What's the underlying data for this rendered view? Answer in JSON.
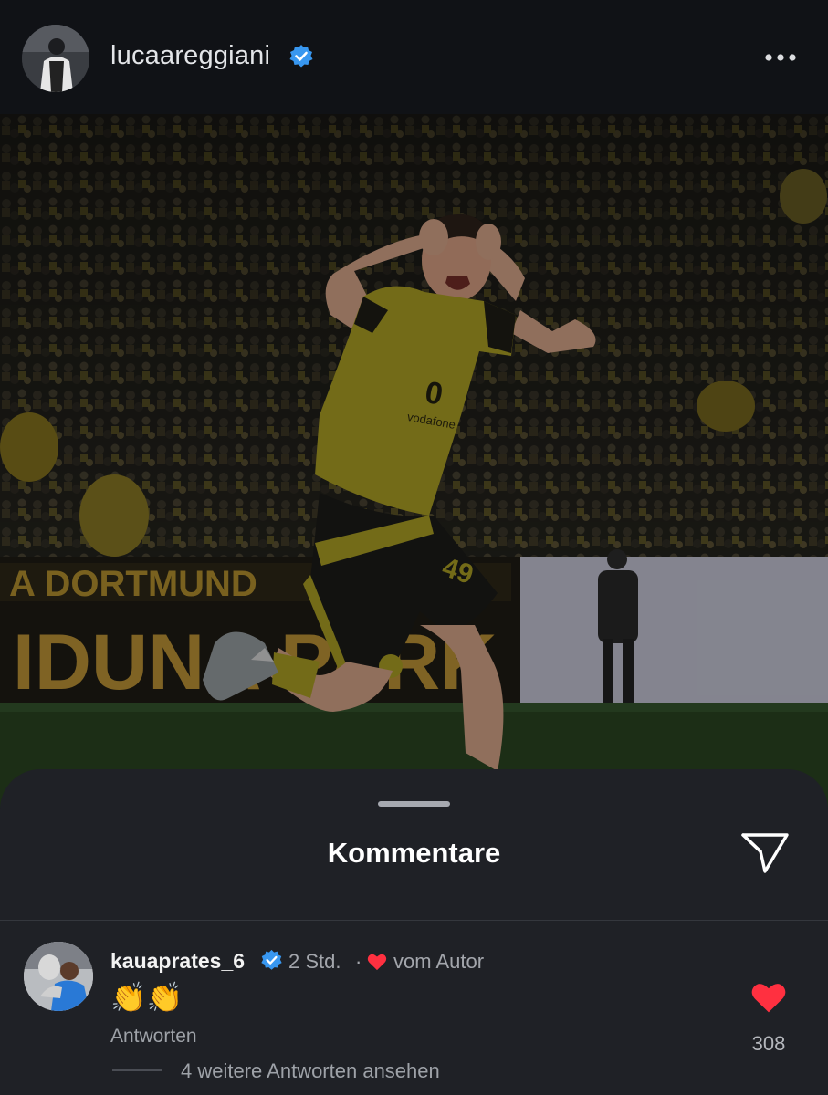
{
  "post": {
    "username": "lucaareggiani",
    "verified": true,
    "more_icon": "more-horizontal-icon",
    "photo_banner_top": "A DORTMUND",
    "photo_banner_main": "IDUNA PARK",
    "jersey_sponsor": "vodafone",
    "shorts_number": "49"
  },
  "comments_sheet": {
    "title": "Kommentare",
    "share_icon": "send-icon",
    "comment": {
      "username": "kauaprates_6",
      "verified": true,
      "time": "2 Std.",
      "separator": "·",
      "author_like_label": "vom Autor",
      "text": "👏👏",
      "reply_label": "Antworten",
      "like_count": "308",
      "view_replies_label": "4 weitere Antworten ansehen"
    }
  },
  "colors": {
    "background": "#0d0d10",
    "sheet": "#1f2126",
    "verified_blue": "#3897f0",
    "like_red": "#ff3040",
    "text_secondary": "#a3a6ac"
  }
}
